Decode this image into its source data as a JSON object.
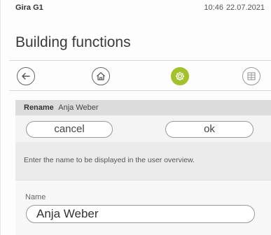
{
  "status_bar": {
    "brand": "Gira G1",
    "time": "10:46",
    "date": "22.07.2021"
  },
  "title": "Building functions",
  "nav": {
    "icons": [
      "back-arrow-icon",
      "home-icon",
      "settings-gear-icon",
      "grid-icon"
    ],
    "active_color": "#a3c12b"
  },
  "rename_panel": {
    "label": "Rename",
    "target": "Anja Weber",
    "cancel_label": "cancel",
    "ok_label": "ok",
    "instruction": "Enter the name to be displayed in the user overview.",
    "field_label": "Name",
    "field_value": "Anja Weber"
  }
}
